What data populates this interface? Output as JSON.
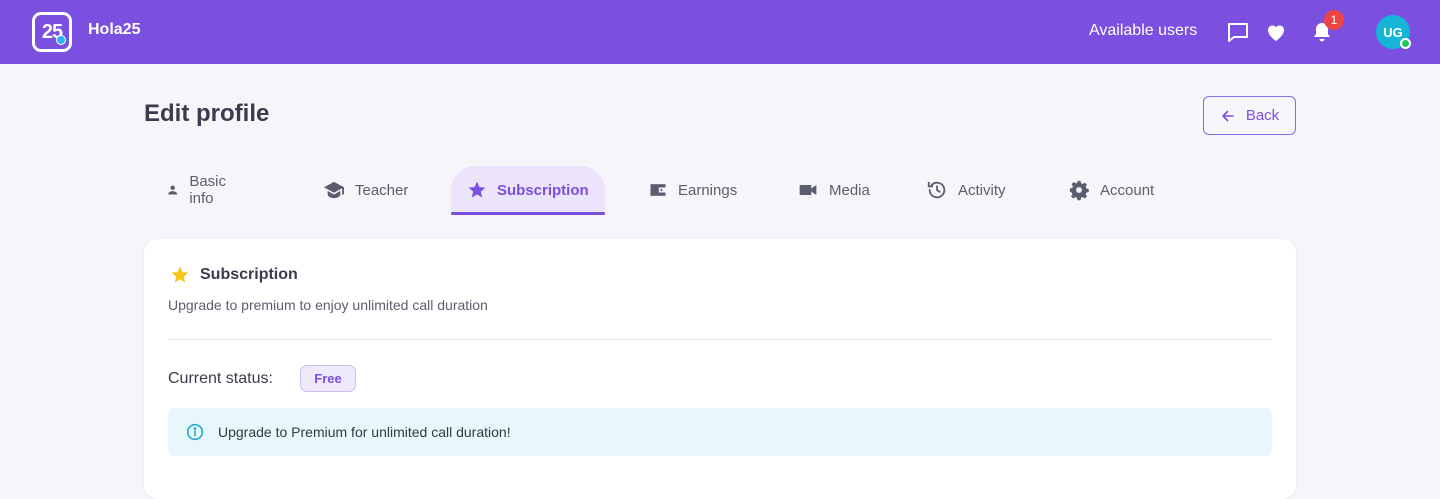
{
  "header": {
    "logo_text": "25",
    "app_name": "Hola25",
    "available_users": "Available users",
    "notification_count": "1",
    "avatar_initials": "UG",
    "colors": {
      "bar": "#7b4fe0",
      "badge": "#ef4444",
      "avatar": "#16b5d6",
      "online": "#22c55e"
    }
  },
  "page": {
    "title": "Edit profile",
    "back_label": "Back"
  },
  "tabs": [
    {
      "label": "Basic info",
      "icon": "person-icon",
      "active": false
    },
    {
      "label": "Teacher",
      "icon": "graduation-cap-icon",
      "active": false
    },
    {
      "label": "Subscription",
      "icon": "star-icon",
      "active": true
    },
    {
      "label": "Earnings",
      "icon": "wallet-icon",
      "active": false
    },
    {
      "label": "Media",
      "icon": "video-camera-icon",
      "active": false
    },
    {
      "label": "Activity",
      "icon": "history-icon",
      "active": false
    },
    {
      "label": "Account",
      "icon": "gear-icon",
      "active": false
    }
  ],
  "subscription": {
    "title": "Subscription",
    "subtitle": "Upgrade to premium to enjoy unlimited call duration",
    "status_label": "Current status:",
    "status_value": "Free",
    "info_text": "Upgrade to Premium for unlimited call duration!"
  }
}
